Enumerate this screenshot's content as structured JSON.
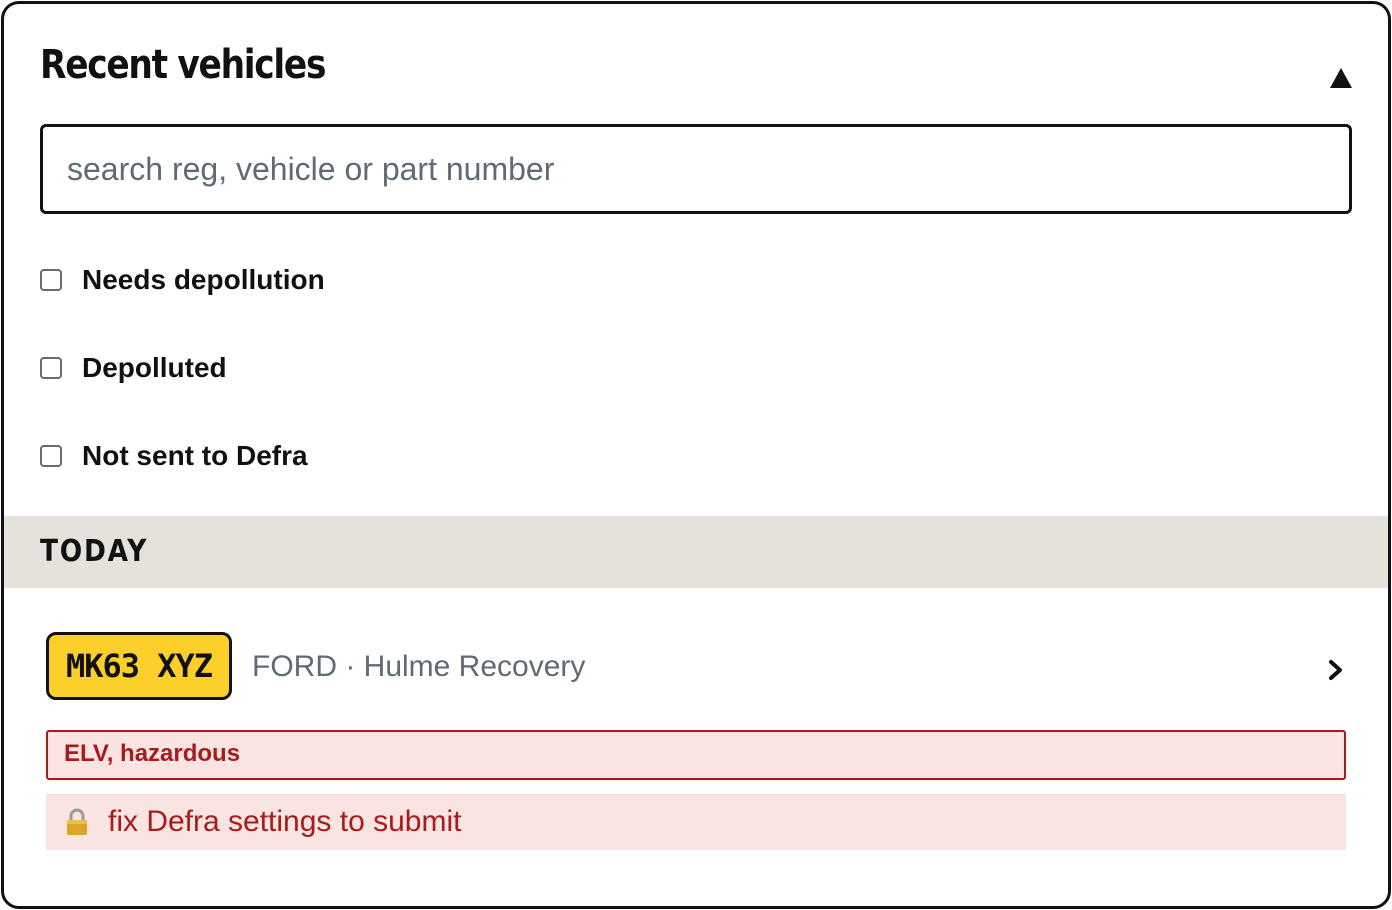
{
  "panel": {
    "title": "Recent vehicles",
    "collapse_icon": "triangle-up-icon"
  },
  "search": {
    "placeholder": "search reg, vehicle or part number",
    "value": ""
  },
  "filters": [
    {
      "label": "Needs depollution",
      "checked": false
    },
    {
      "label": "Depolluted",
      "checked": false
    },
    {
      "label": "Not sent to Defra",
      "checked": false
    }
  ],
  "sections": [
    {
      "title": "TODAY",
      "vehicles": [
        {
          "registration": "MK63 XYZ",
          "description": "FORD · Hulme Recovery",
          "warning": "ELV, hazardous",
          "notice": "fix Defra settings to submit",
          "notice_icon": "lock-icon"
        }
      ]
    }
  ],
  "colors": {
    "plate_yellow": "#fdcf2a",
    "section_band": "#e4e2da",
    "alert_red": "#a61b1b",
    "alert_bg": "#f9e4e1",
    "muted_text": "#5f6b73"
  }
}
